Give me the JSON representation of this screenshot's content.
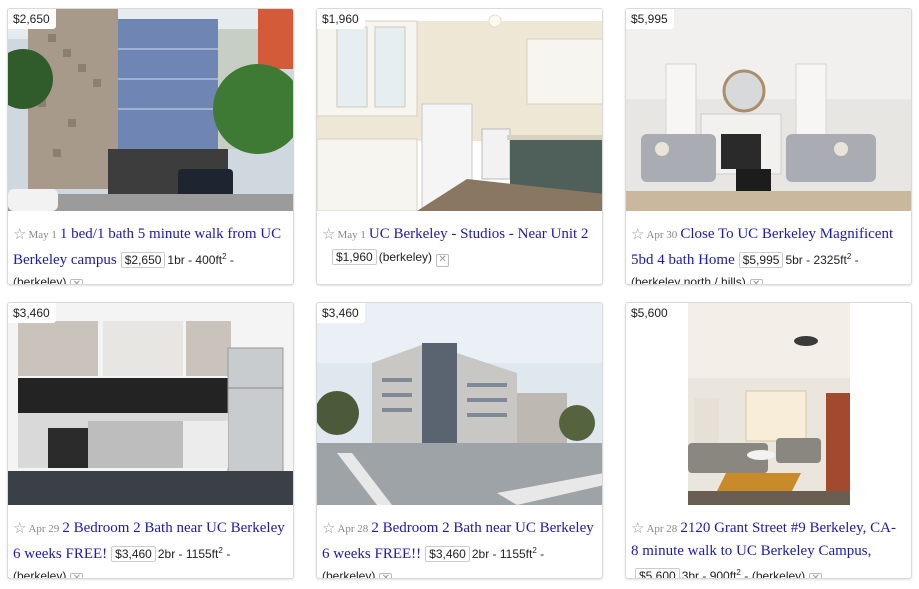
{
  "listings": [
    {
      "price": "$2,650",
      "date": "May 1",
      "title": "1 bed/1 bath 5 minute walk from UC Berkeley campus",
      "housing_size": "1br - 400ft",
      "sup": "2",
      "hood": "(berkeley)"
    },
    {
      "price": "$1,960",
      "date": "May 1",
      "title": "UC Berkeley - Studios - Near Unit 2",
      "housing_size": "",
      "sup": "",
      "hood": "(berkeley)"
    },
    {
      "price": "$5,995",
      "date": "Apr 30",
      "title": "Close To UC Berkeley Magnificent 5bd 4 bath Home",
      "housing_size": "5br - 2325ft",
      "sup": "2",
      "hood": "(berkeley north / hills)"
    },
    {
      "price": "$3,460",
      "date": "Apr 29",
      "title": "2 Bedroom 2 Bath near UC Berkeley 6 weeks FREE!",
      "housing_size": "2br - 1155ft",
      "sup": "2",
      "hood": "(berkeley)"
    },
    {
      "price": "$3,460",
      "date": "Apr 28",
      "title": "2 Bedroom 2 Bath near UC Berkeley 6 weeks FREE!!",
      "housing_size": "2br - 1155ft",
      "sup": "2",
      "hood": "(berkeley)"
    },
    {
      "price": "$5,600",
      "date": "Apr 28",
      "title": "2120 Grant Street #9 Berkeley, CA- 8 minute walk to UC Berkeley Campus,",
      "housing_size": "3br - 900ft",
      "sup": "2",
      "hood": "(berkeley)"
    }
  ],
  "icons": {
    "favorite": "star-icon",
    "hide": "hide-posting-icon"
  },
  "colors": {
    "title_link": "#1a1ab8",
    "date": "#888888"
  }
}
